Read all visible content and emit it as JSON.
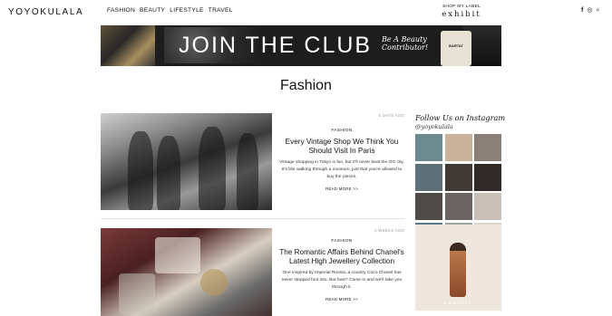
{
  "header": {
    "logo": "YOYOKULALA",
    "nav": [
      "FASHION",
      "BEAUTY",
      "LIFESTYLE",
      "TRAVEL"
    ],
    "shop_label": "SHOP MY LABEL",
    "shop_brand": "exhibit",
    "social_icons": {
      "facebook": "f",
      "instagram": "◎",
      "search": "⌕"
    }
  },
  "banner": {
    "headline": "JOIN THE CLUB",
    "subline": "Be A Beauty Contributor!",
    "product_label": "BARTAT"
  },
  "page": {
    "title": "Fashion"
  },
  "articles": [
    {
      "date": "5 DAYS AGO",
      "category": "FASHION",
      "title": "Every Vintage Shop We Think You Should Visit In Paris",
      "excerpt": "Vintage shopping in Tokyo is fun, but it'll never beat the OG city. It's like walking through a museum, just that you're allowed to buy the pieces.",
      "read_more": "READ MORE >>"
    },
    {
      "date": "2 WEEKS AGO",
      "category": "FASHION",
      "title": "The Romantic Affairs Behind Chanel's Latest High Jewellery Collection",
      "excerpt": "One inspired by Imperial Russia, a country Coco Chanel has never stepped foot into. But how? Come in and we'll take you through it.",
      "read_more": "READ MORE >>"
    }
  ],
  "sidebar": {
    "instagram_title": "Follow Us on Instagram",
    "instagram_handle": "@yoyokulala",
    "grid_colors": [
      "#6c8a8e",
      "#c9b39a",
      "#8a7f78",
      "#5e7077",
      "#3f3a36",
      "#2f2a28",
      "#4e4a48",
      "#6a6562",
      "#c8c0b6",
      "#5a7a8c",
      "#9ba6a0",
      "#d9d4cc"
    ],
    "ad_brand": "exhibit"
  }
}
